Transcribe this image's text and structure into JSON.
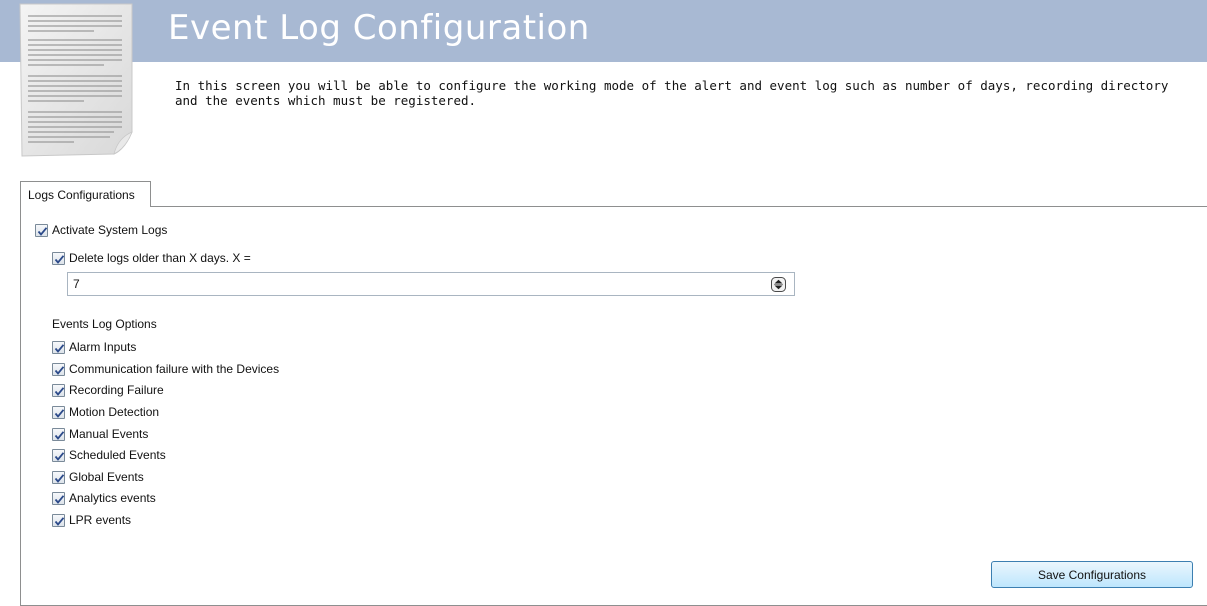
{
  "header": {
    "title": "Event Log Configuration",
    "intro": "In this screen you will be able to configure the working mode of the alert and event log such as number of days, recording directory and the events which must be registered."
  },
  "tabs": [
    {
      "label": "Logs Configurations"
    }
  ],
  "settings": {
    "activate_logs": {
      "label": "Activate System Logs",
      "checked": true
    },
    "delete_logs": {
      "label": "Delete logs older than X days. X =",
      "checked": true
    },
    "days_value": "7"
  },
  "events": {
    "section_label": "Events Log Options",
    "items": [
      {
        "label": "Alarm Inputs",
        "checked": true
      },
      {
        "label": "Communication failure with the Devices",
        "checked": true
      },
      {
        "label": "Recording Failure",
        "checked": true
      },
      {
        "label": "Motion Detection",
        "checked": true
      },
      {
        "label": "Manual Events",
        "checked": true
      },
      {
        "label": "Scheduled Events",
        "checked": true
      },
      {
        "label": "Global Events",
        "checked": true
      },
      {
        "label": "Analytics events",
        "checked": true
      },
      {
        "label": "LPR events",
        "checked": true
      }
    ]
  },
  "actions": {
    "save_label": "Save Configurations"
  },
  "colors": {
    "header_band": "#a8b9d3",
    "check_mark": "#2c4a8a",
    "button_border": "#3c7fb1"
  }
}
